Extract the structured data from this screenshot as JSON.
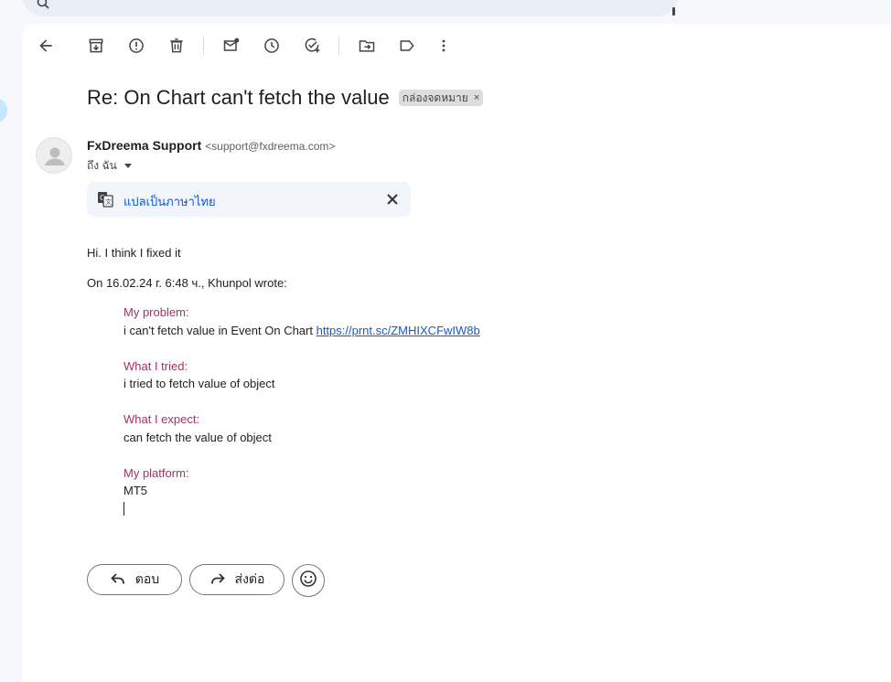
{
  "email": {
    "subject": "Re: On Chart can't fetch the value",
    "label_chip": "กล่องจดหมาย",
    "label_remove": "×",
    "sender_name": "FxDreema Support",
    "sender_email": "<support@fxdreema.com>",
    "to_label": "ถึง ฉัน",
    "translate_link": "แปลเป็นภาษาไทย",
    "body_line": "Hi. I think I fixed it",
    "quote_header": "On 16.02.24 г. 6:48 ч., Khunpol wrote:",
    "quoted": {
      "problem_head": "My problem:",
      "problem_body": "i can't fetch value in Event On Chart ",
      "problem_link": "https://prnt.sc/ZMHIXCFwIW8b",
      "tried_head": "What I tried:",
      "tried_body": "i tried to fetch value of object",
      "expect_head": "What I expect:",
      "expect_body": "can fetch the value of object",
      "platform_head": "My platform:",
      "platform_body": "MT5"
    }
  },
  "actions": {
    "reply_label": "ตอบ",
    "forward_label": "ส่งต่อ"
  },
  "toolbar_icons": [
    "back-arrow-icon",
    "archive-icon",
    "report-spam-icon",
    "delete-icon",
    "mark-unread-icon",
    "snooze-icon",
    "add-task-icon",
    "move-to-icon",
    "label-icon",
    "more-vert-icon"
  ],
  "colors": {
    "quote_heading": "#a0336a",
    "link": "#1a57c6",
    "translate_link": "#0b57d0",
    "label_chip_bg": "#dddddd"
  }
}
